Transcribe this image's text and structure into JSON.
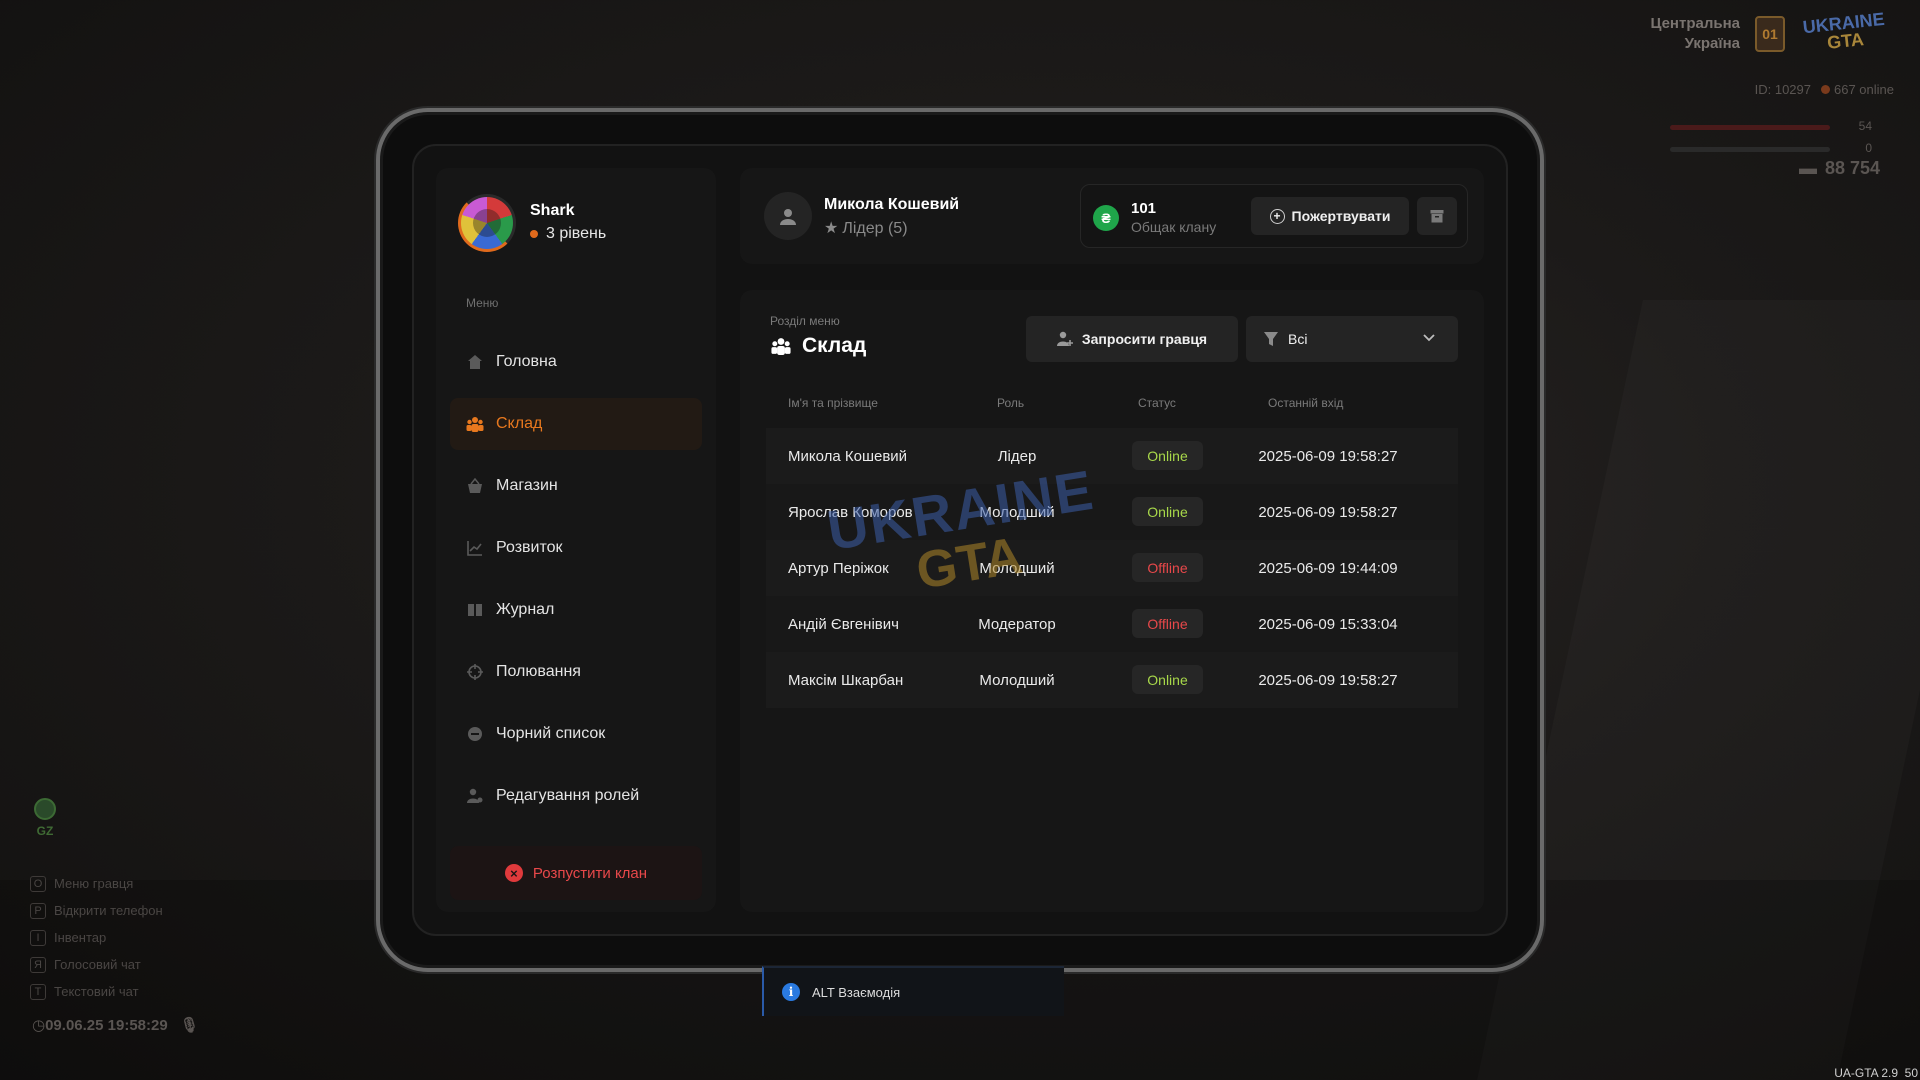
{
  "hud": {
    "region_line1": "Центральна",
    "region_line2": "Україна",
    "region_badge": "01",
    "logo_top": "UKRAINE",
    "logo_bottom": "GTA",
    "player_id": "ID: 10297",
    "online": "667 online",
    "health": "54",
    "armor": "0",
    "money": "88 754",
    "gz_label": "GZ",
    "keyhints": [
      {
        "key": "O",
        "label": "Меню гравця"
      },
      {
        "key": "P",
        "label": "Відкрити телефон"
      },
      {
        "key": "I",
        "label": "Інвентар"
      },
      {
        "key": "Я",
        "label": "Голосовий чат"
      },
      {
        "key": "T",
        "label": "Текстовий чат"
      }
    ],
    "datetime": "09.06.25 19:58:29",
    "version": "UA-GTA 2.9",
    "fps": "50"
  },
  "profile": {
    "name": "Shark",
    "level": "3 рівень"
  },
  "sidebar": {
    "menu_label": "Меню",
    "items": [
      {
        "label": "Головна",
        "icon": "home-icon"
      },
      {
        "label": "Склад",
        "icon": "members-icon",
        "active": true
      },
      {
        "label": "Магазин",
        "icon": "basket-icon"
      },
      {
        "label": "Розвиток",
        "icon": "chart-icon"
      },
      {
        "label": "Журнал",
        "icon": "book-icon"
      },
      {
        "label": "Полювання",
        "icon": "crosshair-icon"
      },
      {
        "label": "Чорний список",
        "icon": "block-icon"
      },
      {
        "label": "Редагування ролей",
        "icon": "user-edit-icon"
      }
    ],
    "disband_label": "Розпустити клан"
  },
  "header": {
    "leader_name": "Микола Кошевий",
    "leader_role": "Лідер (5)",
    "bank_currency": "₴",
    "bank_amount": "101",
    "bank_label": "Общак клану",
    "donate_label": "Пожертвувати"
  },
  "section": {
    "label": "Розділ меню",
    "title": "Склад",
    "invite_label": "Запросити гравця",
    "filter_value": "Всі"
  },
  "table": {
    "columns": [
      "Ім'я та прізвище",
      "Роль",
      "Статус",
      "Останній вхід"
    ],
    "rows": [
      {
        "name": "Микола Кошевий",
        "role": "Лідер",
        "status": "Online",
        "last": "2025-06-09 19:58:27"
      },
      {
        "name": "Ярослав Коморов",
        "role": "Молодший",
        "status": "Online",
        "last": "2025-06-09 19:58:27"
      },
      {
        "name": "Артур Періжок",
        "role": "Молодший",
        "status": "Offline",
        "last": "2025-06-09 19:44:09"
      },
      {
        "name": "Андій Євгенівич",
        "role": "Модератор",
        "status": "Offline",
        "last": "2025-06-09 15:33:04"
      },
      {
        "name": "Максім Шкарбан",
        "role": "Молодший",
        "status": "Online",
        "last": "2025-06-09 19:58:27"
      }
    ]
  },
  "watermark": {
    "top": "UKRAINE",
    "bottom": "GTA"
  },
  "prompt": {
    "label": "ALT Взаємодія"
  },
  "colors": {
    "accent": "#e8781e",
    "online": "#a8d84a",
    "offline": "#e8484a",
    "bank": "#1fa54a"
  }
}
